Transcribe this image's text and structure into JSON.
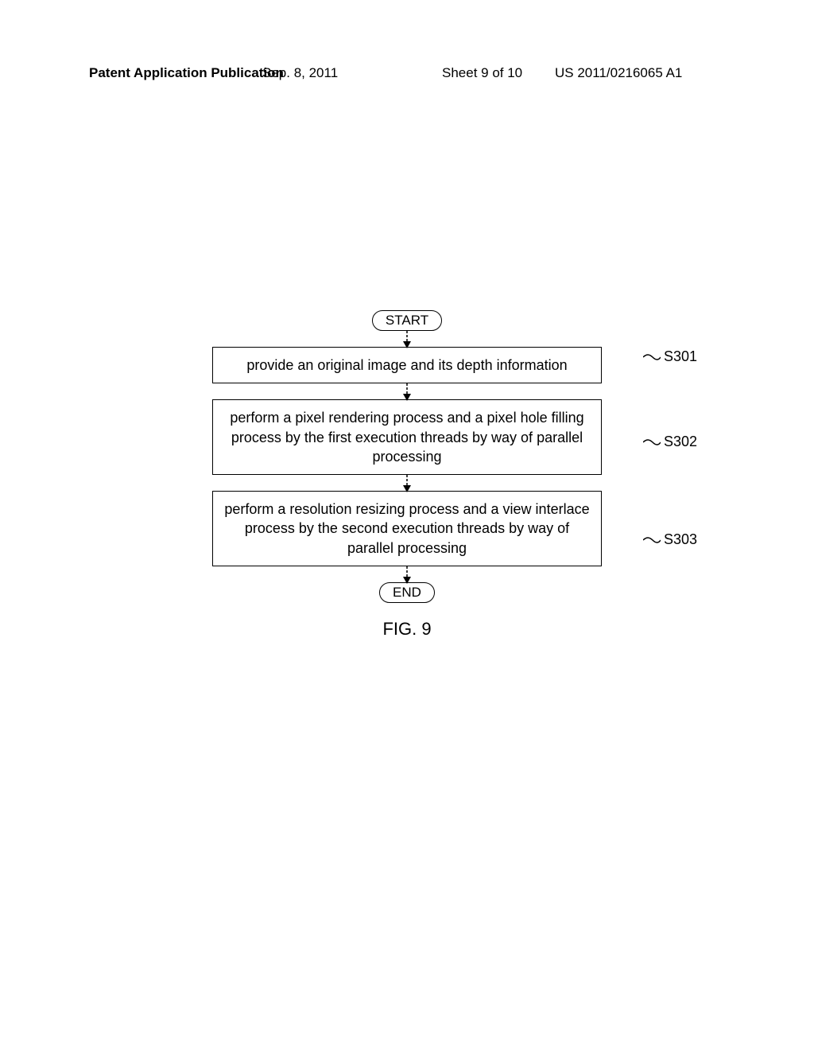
{
  "header": {
    "left": "Patent Application Publication",
    "center": "Sep. 8, 2011",
    "sheet": "Sheet 9 of 10",
    "pubnum": "US 2011/0216065 A1"
  },
  "flowchart": {
    "start": "START",
    "end": "END",
    "steps": [
      {
        "label": "S301",
        "text": "provide an original image and its depth information"
      },
      {
        "label": "S302",
        "text": "perform a pixel rendering process and a pixel hole filling process by the first execution threads by way of parallel processing"
      },
      {
        "label": "S303",
        "text": "perform a resolution resizing process and a view interlace process by the second execution threads by way of parallel processing"
      }
    ]
  },
  "figure_label": "FIG. 9"
}
